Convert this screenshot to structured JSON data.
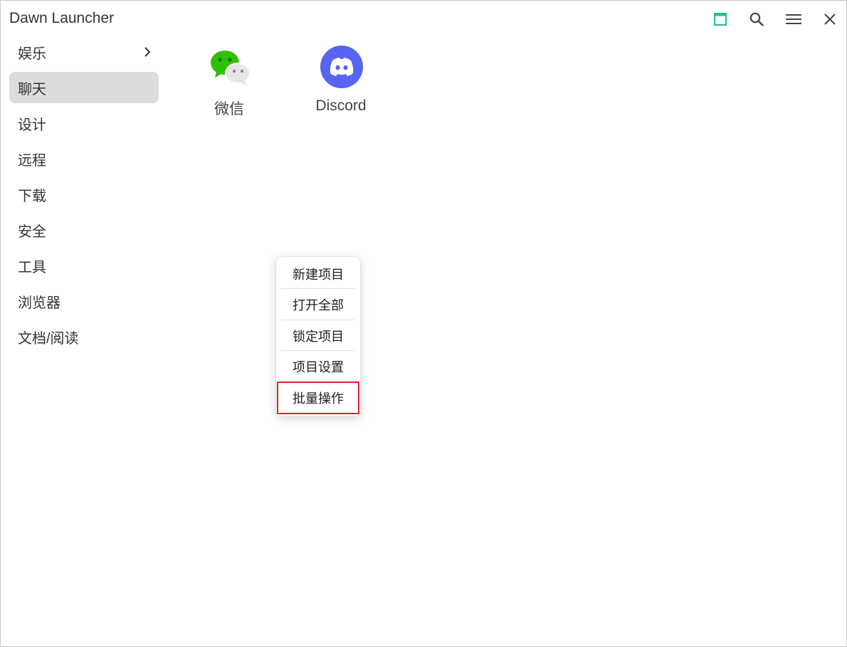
{
  "window": {
    "title": "Dawn Launcher"
  },
  "titlebar": {
    "buttons": [
      {
        "name": "window-toggle",
        "icon": "square-icon",
        "color": "#1fbf8f"
      },
      {
        "name": "search",
        "icon": "search-icon",
        "color": "#444444"
      },
      {
        "name": "menu",
        "icon": "hamburger-icon",
        "color": "#444444"
      },
      {
        "name": "close",
        "icon": "close-icon",
        "color": "#444444"
      }
    ]
  },
  "sidebar": {
    "items": [
      {
        "label": "娱乐",
        "has_submenu": true,
        "active": false
      },
      {
        "label": "聊天",
        "has_submenu": false,
        "active": true
      },
      {
        "label": "设计",
        "has_submenu": false,
        "active": false
      },
      {
        "label": "远程",
        "has_submenu": false,
        "active": false
      },
      {
        "label": "下载",
        "has_submenu": false,
        "active": false
      },
      {
        "label": "安全",
        "has_submenu": false,
        "active": false
      },
      {
        "label": "工具",
        "has_submenu": false,
        "active": false
      },
      {
        "label": "浏览器",
        "has_submenu": false,
        "active": false
      },
      {
        "label": "文档/阅读",
        "has_submenu": false,
        "active": false
      }
    ]
  },
  "apps": [
    {
      "label": "微信",
      "icon": "wechat-icon",
      "color": "#2dc100"
    },
    {
      "label": "Discord",
      "icon": "discord-icon",
      "color": "#5865f2"
    }
  ],
  "context_menu": {
    "items": [
      {
        "label": "新建项目",
        "highlighted": false
      },
      {
        "label": "打开全部",
        "highlighted": false
      },
      {
        "label": "锁定项目",
        "highlighted": false
      },
      {
        "label": "项目设置",
        "highlighted": false
      },
      {
        "label": "批量操作",
        "highlighted": true
      }
    ],
    "highlight_color": "#e0202a"
  }
}
